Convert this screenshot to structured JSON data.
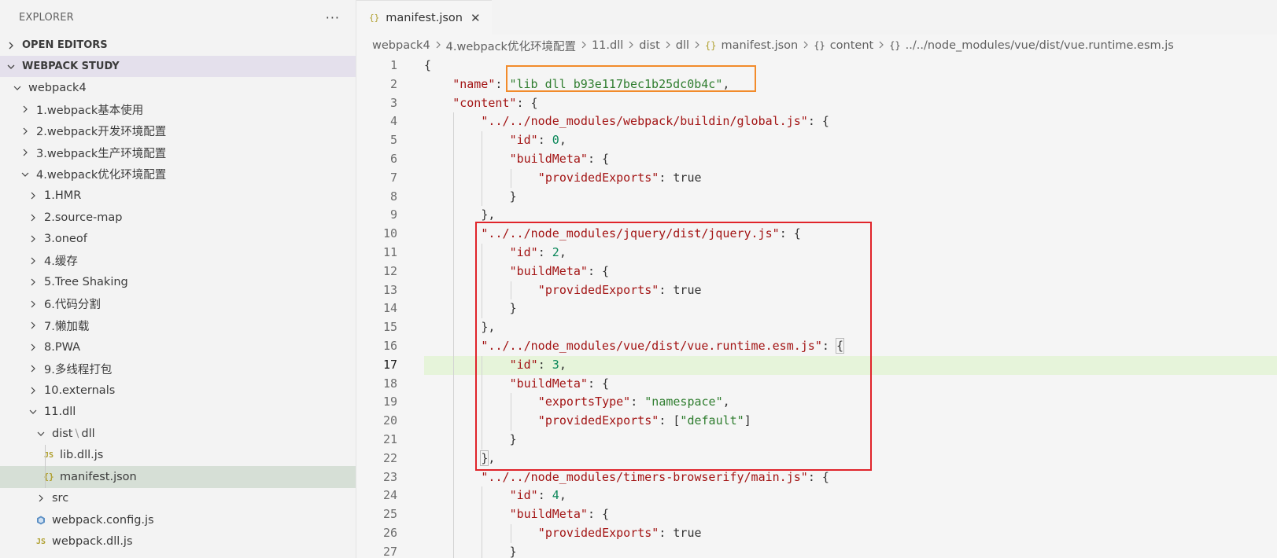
{
  "explorer": {
    "title": "EXPLORER",
    "more": "···",
    "sections": {
      "open_editors": "OPEN EDITORS",
      "workspace": "WEBPACK STUDY"
    },
    "tree": [
      {
        "label": "webpack4",
        "depth": 1,
        "expanded": true
      },
      {
        "label": "1.webpack基本使用",
        "depth": 2,
        "expanded": false
      },
      {
        "label": "2.webpack开发环境配置",
        "depth": 2,
        "expanded": false
      },
      {
        "label": "3.webpack生产环境配置",
        "depth": 2,
        "expanded": false
      },
      {
        "label": "4.webpack优化环境配置",
        "depth": 2,
        "expanded": true
      },
      {
        "label": "1.HMR",
        "depth": 3,
        "expanded": false
      },
      {
        "label": "2.source-map",
        "depth": 3,
        "expanded": false
      },
      {
        "label": "3.oneof",
        "depth": 3,
        "expanded": false
      },
      {
        "label": "4.缓存",
        "depth": 3,
        "expanded": false
      },
      {
        "label": "5.Tree Shaking",
        "depth": 3,
        "expanded": false
      },
      {
        "label": "6.代码分割",
        "depth": 3,
        "expanded": false
      },
      {
        "label": "7.懒加载",
        "depth": 3,
        "expanded": false
      },
      {
        "label": "8.PWA",
        "depth": 3,
        "expanded": false
      },
      {
        "label": "9.多线程打包",
        "depth": 3,
        "expanded": false
      },
      {
        "label": "10.externals",
        "depth": 3,
        "expanded": false
      },
      {
        "label": "11.dll",
        "depth": 3,
        "expanded": true
      },
      {
        "label_a": "dist",
        "label_sep": "\\",
        "label_b": "dll",
        "depth": 4,
        "expanded": true
      },
      {
        "label": "lib.dll.js",
        "depth": 5,
        "icon": "JS"
      },
      {
        "label": "manifest.json",
        "depth": 5,
        "icon": "{}",
        "selected": true
      },
      {
        "label": "src",
        "depth": 4,
        "expanded": false
      },
      {
        "label": "webpack.config.js",
        "depth": 4,
        "icon": "config"
      },
      {
        "label": "webpack.dll.js",
        "depth": 4,
        "icon": "JS"
      }
    ]
  },
  "editor": {
    "tab": {
      "icon": "{}",
      "label": "manifest.json",
      "close": "✕"
    },
    "breadcrumb": [
      {
        "label": "webpack4"
      },
      {
        "label": "4.webpack优化环境配置"
      },
      {
        "label": "11.dll"
      },
      {
        "label": "dist"
      },
      {
        "label": "dll"
      },
      {
        "icon": "{}",
        "label": "manifest.json",
        "json": true
      },
      {
        "icon": "{}",
        "label": "content"
      },
      {
        "icon": "{}",
        "label": "../../node_modules/vue/dist/vue.runtime.esm.js"
      }
    ],
    "active_line": 17,
    "lines": [
      {
        "n": "1",
        "i": 0,
        "t": [
          [
            "p",
            "{"
          ]
        ]
      },
      {
        "n": "2",
        "i": 1,
        "t": [
          [
            "k",
            "\"name\""
          ],
          [
            "p",
            ": "
          ],
          [
            "s",
            "\"lib_dll_b93e117bec1b25dc0b4c\""
          ],
          [
            "p",
            ","
          ]
        ]
      },
      {
        "n": "3",
        "i": 1,
        "t": [
          [
            "k",
            "\"content\""
          ],
          [
            "p",
            ": {"
          ]
        ]
      },
      {
        "n": "4",
        "i": 2,
        "t": [
          [
            "k",
            "\"../../node_modules/webpack/buildin/global.js\""
          ],
          [
            "p",
            ": {"
          ]
        ]
      },
      {
        "n": "5",
        "i": 3,
        "t": [
          [
            "k",
            "\"id\""
          ],
          [
            "p",
            ": "
          ],
          [
            "n",
            "0"
          ],
          [
            "p",
            ","
          ]
        ]
      },
      {
        "n": "6",
        "i": 3,
        "t": [
          [
            "k",
            "\"buildMeta\""
          ],
          [
            "p",
            ": {"
          ]
        ]
      },
      {
        "n": "7",
        "i": 4,
        "t": [
          [
            "k",
            "\"providedExports\""
          ],
          [
            "p",
            ": "
          ],
          [
            "b",
            "true"
          ]
        ]
      },
      {
        "n": "8",
        "i": 3,
        "t": [
          [
            "p",
            "}"
          ]
        ]
      },
      {
        "n": "9",
        "i": 2,
        "t": [
          [
            "p",
            "},"
          ]
        ]
      },
      {
        "n": "10",
        "i": 2,
        "t": [
          [
            "k",
            "\"../../node_modules/jquery/dist/jquery.js\""
          ],
          [
            "p",
            ": {"
          ]
        ]
      },
      {
        "n": "11",
        "i": 3,
        "t": [
          [
            "k",
            "\"id\""
          ],
          [
            "p",
            ": "
          ],
          [
            "n",
            "2"
          ],
          [
            "p",
            ","
          ]
        ]
      },
      {
        "n": "12",
        "i": 3,
        "t": [
          [
            "k",
            "\"buildMeta\""
          ],
          [
            "p",
            ": {"
          ]
        ]
      },
      {
        "n": "13",
        "i": 4,
        "t": [
          [
            "k",
            "\"providedExports\""
          ],
          [
            "p",
            ": "
          ],
          [
            "b",
            "true"
          ]
        ]
      },
      {
        "n": "14",
        "i": 3,
        "t": [
          [
            "p",
            "}"
          ]
        ]
      },
      {
        "n": "15",
        "i": 2,
        "t": [
          [
            "p",
            "},"
          ]
        ]
      },
      {
        "n": "16",
        "i": 2,
        "t": [
          [
            "k",
            "\"../../node_modules/vue/dist/vue.runtime.esm.js\""
          ],
          [
            "p",
            ": "
          ],
          [
            "br",
            "{"
          ]
        ]
      },
      {
        "n": "17",
        "i": 3,
        "t": [
          [
            "k",
            "\"id\""
          ],
          [
            "p",
            ": "
          ],
          [
            "n",
            "3"
          ],
          [
            "p",
            ","
          ]
        ]
      },
      {
        "n": "18",
        "i": 3,
        "t": [
          [
            "k",
            "\"buildMeta\""
          ],
          [
            "p",
            ": {"
          ]
        ]
      },
      {
        "n": "19",
        "i": 4,
        "t": [
          [
            "k",
            "\"exportsType\""
          ],
          [
            "p",
            ": "
          ],
          [
            "s",
            "\"namespace\""
          ],
          [
            "p",
            ","
          ]
        ]
      },
      {
        "n": "20",
        "i": 4,
        "t": [
          [
            "k",
            "\"providedExports\""
          ],
          [
            "p",
            ": ["
          ],
          [
            "s",
            "\"default\""
          ],
          [
            "p",
            "]"
          ]
        ]
      },
      {
        "n": "21",
        "i": 3,
        "t": [
          [
            "p",
            "}"
          ]
        ]
      },
      {
        "n": "22",
        "i": 2,
        "t": [
          [
            "br",
            "}"
          ],
          [
            "p",
            ","
          ]
        ]
      },
      {
        "n": "23",
        "i": 2,
        "t": [
          [
            "k",
            "\"../../node_modules/timers-browserify/main.js\""
          ],
          [
            "p",
            ": {"
          ]
        ]
      },
      {
        "n": "24",
        "i": 3,
        "t": [
          [
            "k",
            "\"id\""
          ],
          [
            "p",
            ": "
          ],
          [
            "n",
            "4"
          ],
          [
            "p",
            ","
          ]
        ]
      },
      {
        "n": "25",
        "i": 3,
        "t": [
          [
            "k",
            "\"buildMeta\""
          ],
          [
            "p",
            ": {"
          ]
        ]
      },
      {
        "n": "26",
        "i": 4,
        "t": [
          [
            "k",
            "\"providedExports\""
          ],
          [
            "p",
            ": "
          ],
          [
            "b",
            "true"
          ]
        ]
      },
      {
        "n": "27",
        "i": 3,
        "t": [
          [
            "p",
            "}"
          ]
        ]
      }
    ]
  },
  "colors": {
    "annotation_orange": "#f28b2b",
    "annotation_red": "#e0242a",
    "active_line_bg": "#e6f4da",
    "selected_item_bg": "#d6dfd6",
    "section_bg": "#e4e0ec"
  }
}
